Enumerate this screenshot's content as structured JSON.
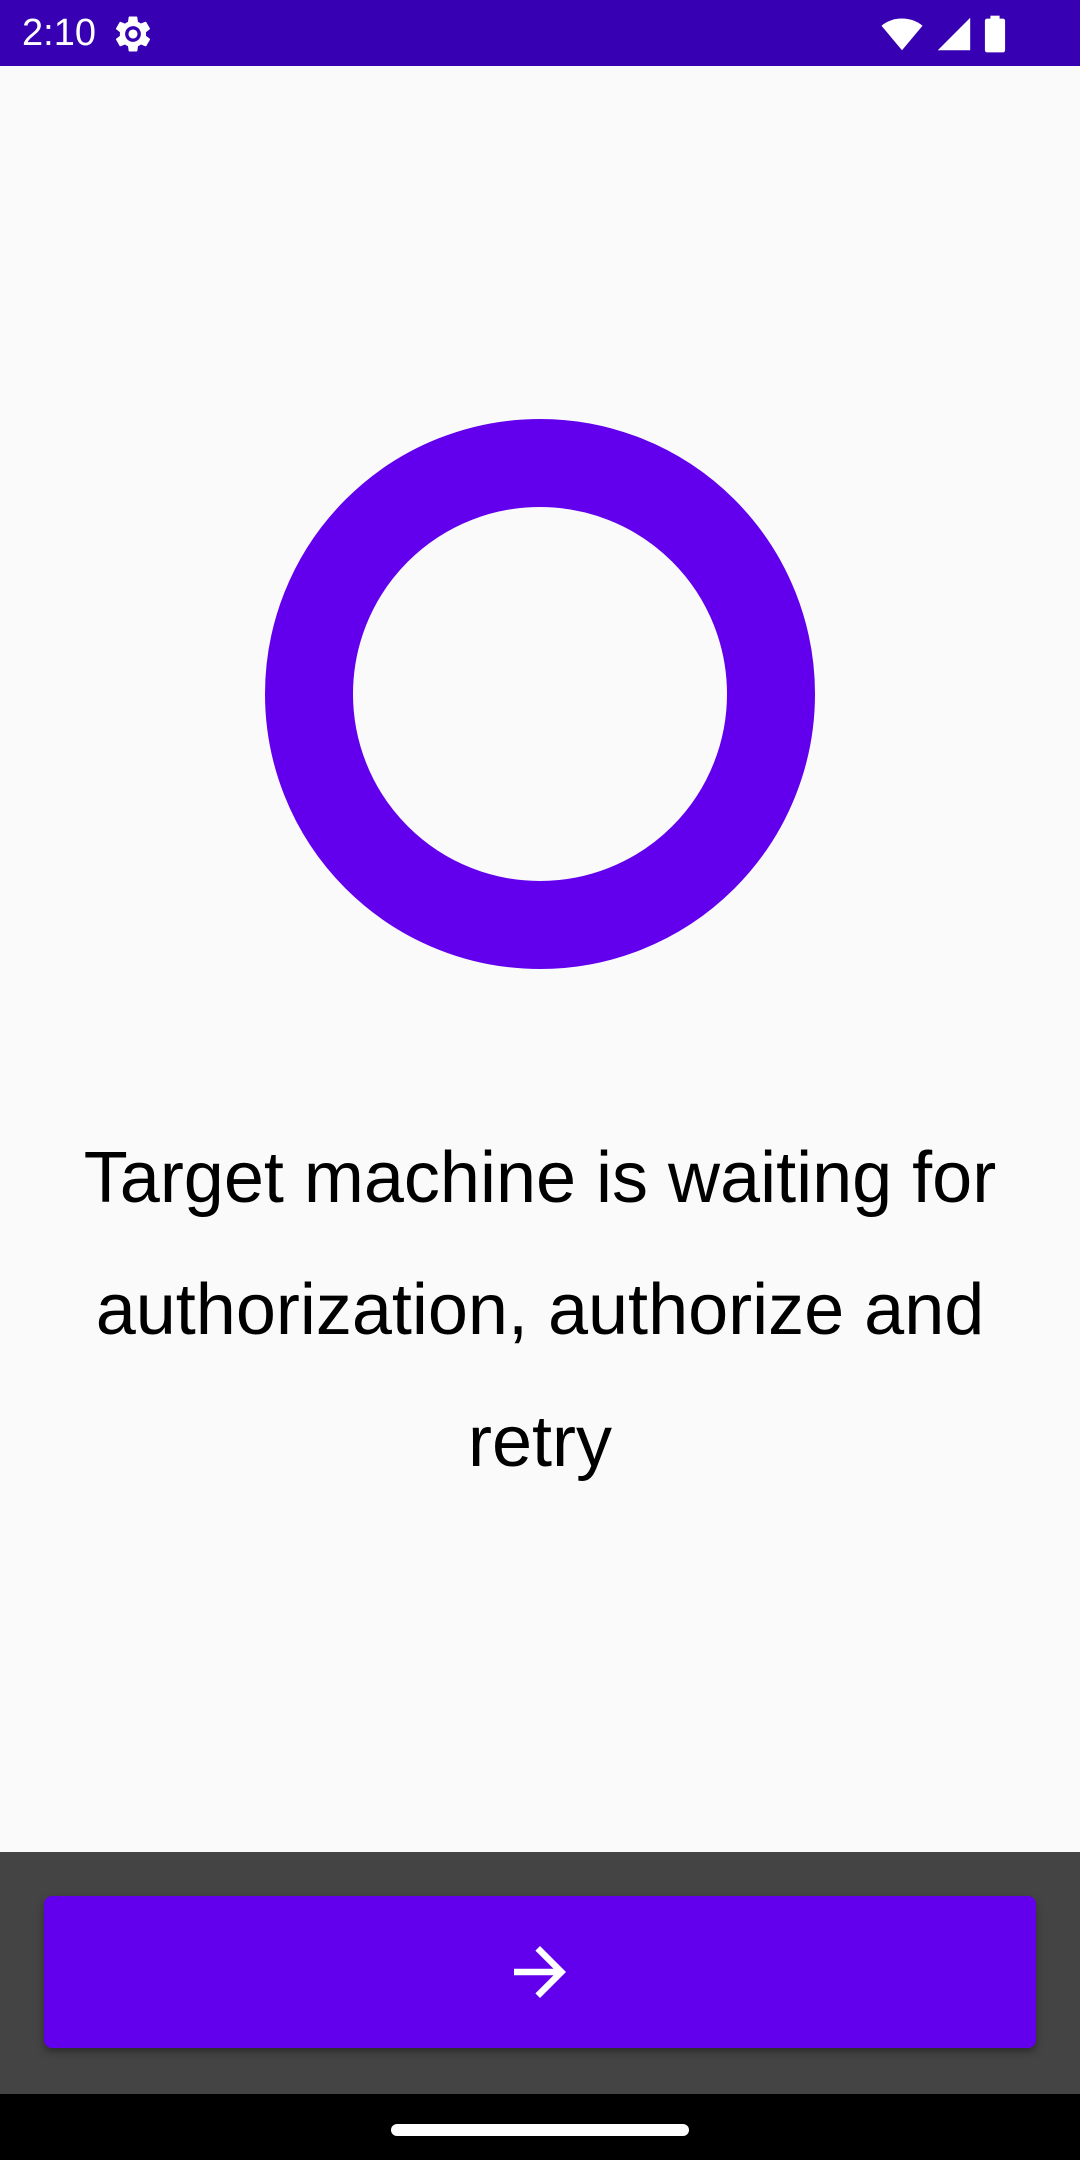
{
  "status_bar": {
    "time": "2:10",
    "background_color": "#3700b3",
    "icons": [
      "settings-gear-icon",
      "wifi-icon",
      "cellular-signal-icon",
      "battery-icon"
    ]
  },
  "progress": {
    "type": "indeterminate-ring",
    "color": "#6200ee"
  },
  "message": {
    "text": "Target machine is waiting for authorization, authorize and retry"
  },
  "bottom_bar": {
    "background_color": "#444444",
    "next_button": {
      "icon": "arrow-right-icon",
      "color": "#6200ee"
    }
  },
  "nav_bar": {
    "handle": "home-gesture-handle"
  }
}
